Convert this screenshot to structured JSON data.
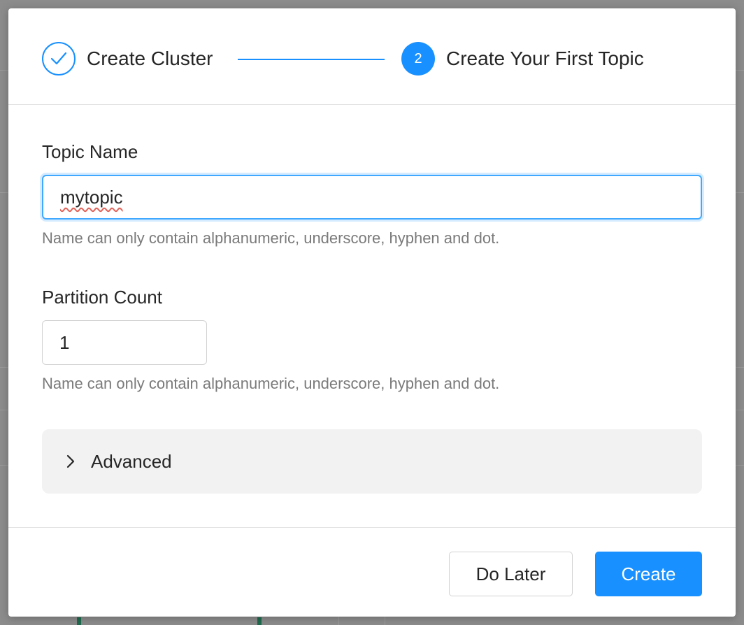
{
  "stepper": {
    "steps": [
      {
        "label": "Create Cluster",
        "status": "done"
      },
      {
        "label": "Create Your First Topic",
        "number": "2",
        "status": "active"
      }
    ]
  },
  "form": {
    "topic_name": {
      "label": "Topic Name",
      "value": "mytopic",
      "help": "Name can only contain alphanumeric, underscore, hyphen and dot."
    },
    "partition_count": {
      "label": "Partition Count",
      "value": "1",
      "help": "Name can only contain alphanumeric, underscore, hyphen and dot."
    },
    "advanced": {
      "label": "Advanced",
      "icon": "chevron-right-icon"
    }
  },
  "footer": {
    "do_later_label": "Do Later",
    "create_label": "Create"
  },
  "colors": {
    "primary": "#1890ff",
    "focus_border": "#40a9ff",
    "panel": "#f2f2f2"
  }
}
